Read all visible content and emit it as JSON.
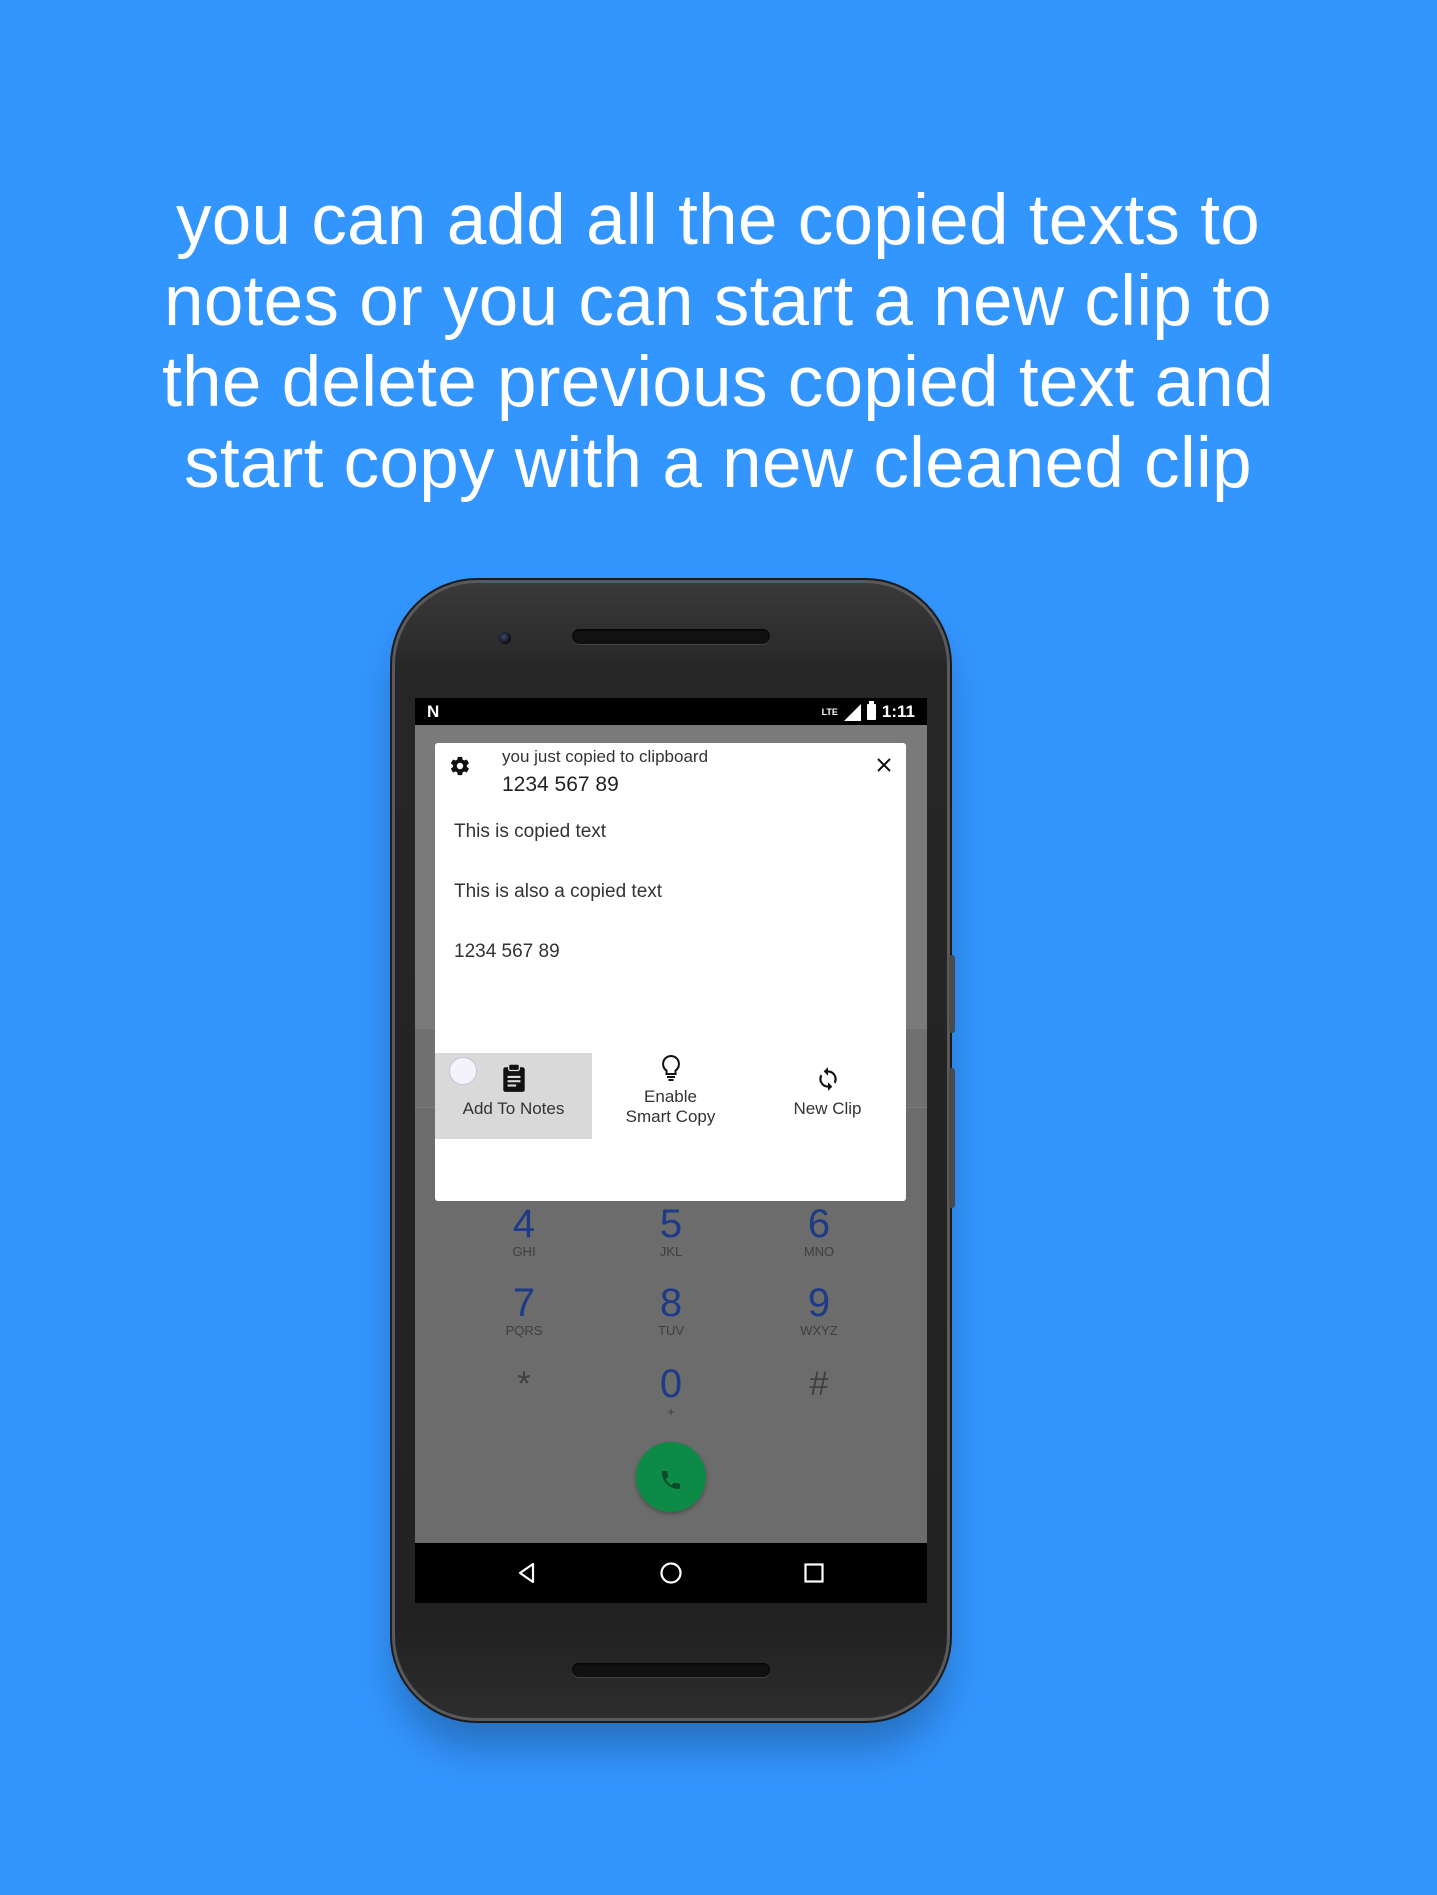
{
  "headline": {
    "lines": [
      "you can add all the copied texts to",
      "notes or you can start a new clip to",
      "the delete previous copied text and",
      "start copy with a new cleaned clip"
    ]
  },
  "statusbar": {
    "left_glyph": "N",
    "network": "LTE",
    "time": "1:11"
  },
  "dialog": {
    "subtitle": "you just copied to clipboard",
    "current_value": "1234 567 89",
    "clips": [
      "This is copied text",
      "This is also a copied text",
      "1234 567 89"
    ],
    "actions": [
      {
        "label_line1": "Add To Notes",
        "label_line2": "",
        "icon": "clipboard-icon"
      },
      {
        "label_line1": "Enable",
        "label_line2": "Smart Copy",
        "icon": "lightbulb-icon"
      },
      {
        "label_line1": "New Clip",
        "label_line2": "",
        "icon": "refresh-icon"
      }
    ]
  },
  "dialer": {
    "rows": [
      [
        {
          "digit": "4",
          "letters": "GHI"
        },
        {
          "digit": "5",
          "letters": "JKL"
        },
        {
          "digit": "6",
          "letters": "MNO"
        }
      ],
      [
        {
          "digit": "7",
          "letters": "PQRS"
        },
        {
          "digit": "8",
          "letters": "TUV"
        },
        {
          "digit": "9",
          "letters": "WXYZ"
        }
      ],
      [
        {
          "digit": "*",
          "letters": ""
        },
        {
          "digit": "0",
          "letters": "+"
        },
        {
          "digit": "#",
          "letters": ""
        }
      ]
    ]
  },
  "colors": {
    "background": "#3395fe",
    "call_button": "#0d8a45",
    "digit": "#1d3a86"
  }
}
